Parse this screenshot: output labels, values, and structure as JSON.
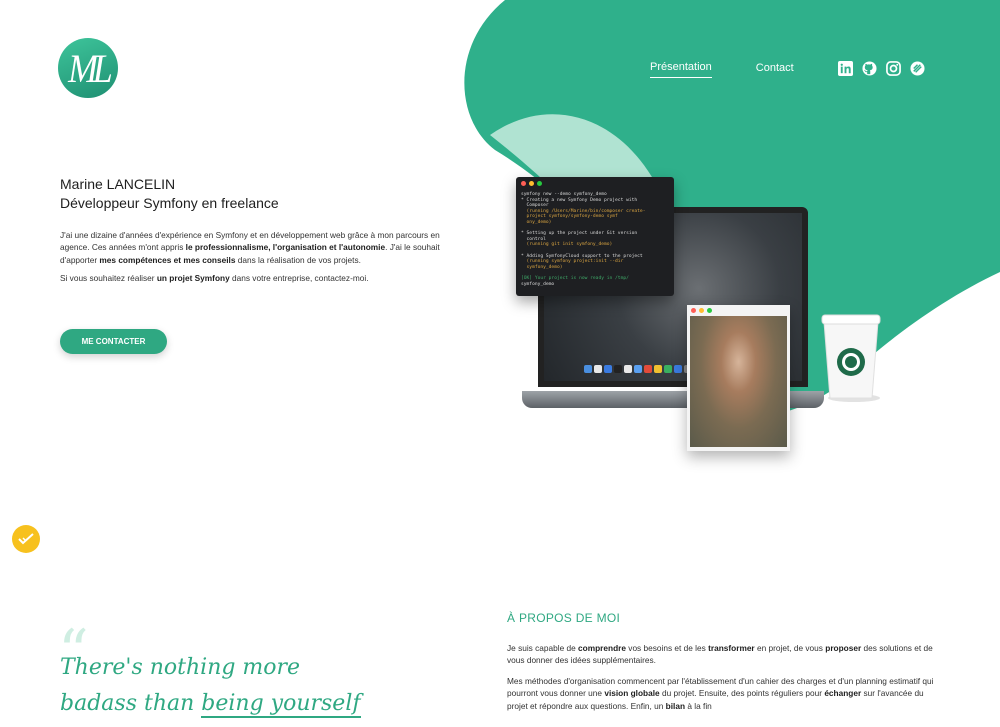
{
  "brand": {
    "logo_text": "ML",
    "accent": "#2fa882",
    "accent_light": "#3ec59b"
  },
  "nav": {
    "items": [
      {
        "label": "Présentation",
        "active": true
      },
      {
        "label": "Contact",
        "active": false
      }
    ],
    "socials": [
      "linkedin-icon",
      "github-icon",
      "instagram-icon",
      "symfony-icon"
    ]
  },
  "hero": {
    "name": "Marine LANCELIN",
    "role": "Développeur Symfony en freelance",
    "p1_a": "J'ai une dizaine d'années d'expérience en Symfony et en développement web grâce à mon parcours en agence. Ces années m'ont appris ",
    "p1_b": "le professionnalisme, l'organisation et l'autonomie",
    "p1_c": ". J'ai le souhait d'apporter ",
    "p1_d": "mes compétences et mes conseils",
    "p1_e": " dans la réalisation de vos projets.",
    "p2_a": "Si vous souhaitez réaliser ",
    "p2_b": "un projet Symfony",
    "p2_c": " dans votre entreprise, contactez-moi.",
    "cta_label": "ME CONTACTER"
  },
  "terminal": {
    "lines": [
      {
        "text": "symfony new --demo symfony_demo",
        "style": ""
      },
      {
        "text": "* Creating a new Symfony Demo project with",
        "style": ""
      },
      {
        "text": "  Composer",
        "style": ""
      },
      {
        "text": "  (running /Users/Marine/bin/composer create-",
        "style": "y"
      },
      {
        "text": "  project symfony/symfony-demo symf",
        "style": "y"
      },
      {
        "text": "  ony_demo)",
        "style": "y"
      },
      {
        "text": "",
        "style": ""
      },
      {
        "text": "* Setting up the project under Git version",
        "style": ""
      },
      {
        "text": "  control",
        "style": ""
      },
      {
        "text": "  (running git init symfony_demo)",
        "style": "y"
      },
      {
        "text": "",
        "style": ""
      },
      {
        "text": "* Adding SymfonyCloud support to the project",
        "style": ""
      },
      {
        "text": "  (running symfony project:init --dir",
        "style": "y"
      },
      {
        "text": "  symfony_demo)",
        "style": "y"
      },
      {
        "text": "",
        "style": ""
      },
      {
        "text": "[OK] Your project is now ready in /tmp/",
        "style": "g"
      },
      {
        "text": "symfony_demo",
        "style": ""
      }
    ]
  },
  "quote": {
    "line1": "There's nothing more",
    "line2a": "badass than ",
    "line2b": "being yourself"
  },
  "about": {
    "title": "À PROPOS DE MOI",
    "p1_a": "Je suis capable de ",
    "p1_b": "comprendre",
    "p1_c": " vos besoins et de les ",
    "p1_d": "transformer",
    "p1_e": " en projet, de vous ",
    "p1_f": "proposer",
    "p1_g": " des solutions et de vous donner des idées supplémentaires.",
    "p2_a": "Mes méthodes d'organisation commencent par l'établissement d'un cahier des charges et d'un planning estimatif qui pourront vous donner une ",
    "p2_b": "vision globale",
    "p2_c": " du projet. Ensuite, des points réguliers pour ",
    "p2_d": "échanger",
    "p2_e": " sur l'avancée du projet et répondre aux questions. Enfin, un ",
    "p2_f": "bilan",
    "p2_g": " à la fin"
  }
}
